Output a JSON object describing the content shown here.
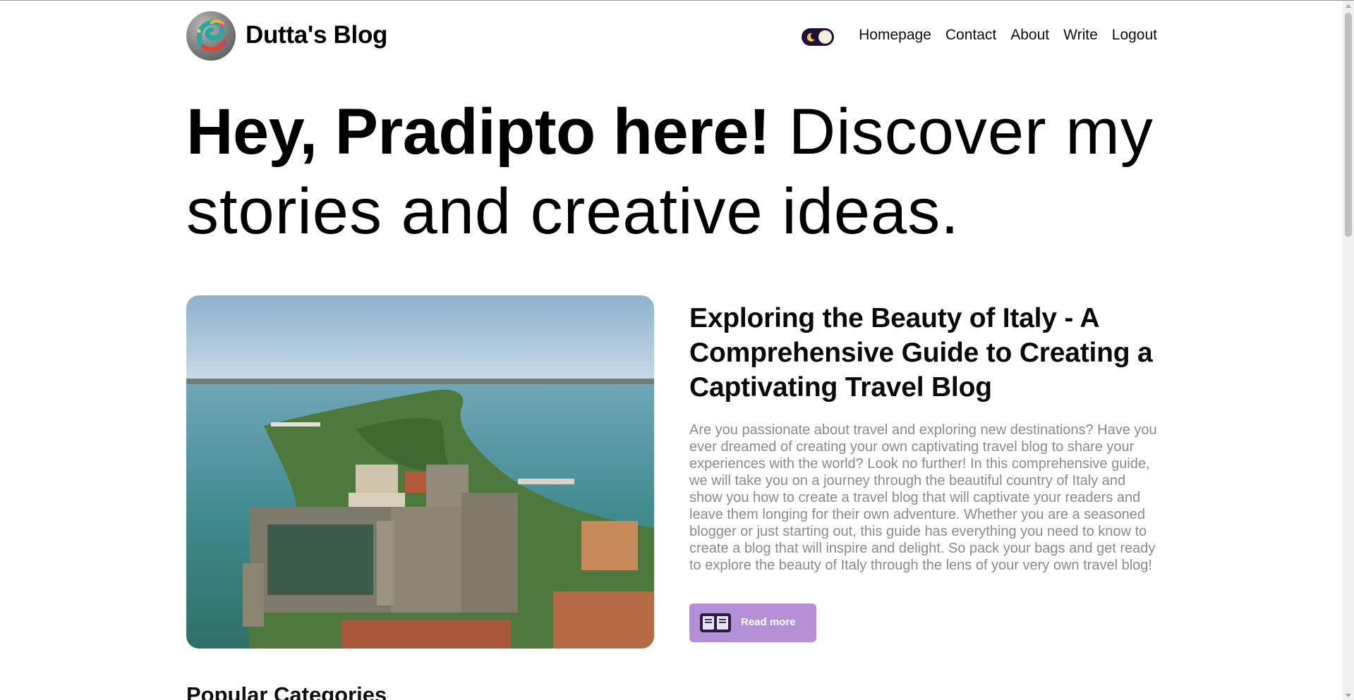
{
  "navbar": {
    "brand": "Dutta's Blog",
    "logo_icon": "colorful-swirl-logo-icon",
    "theme_toggle": {
      "state": "dark",
      "icon": "moon-icon"
    },
    "links": [
      "Homepage",
      "Contact",
      "About",
      "Write",
      "Logout"
    ]
  },
  "hero": {
    "bold": "Hey, Pradipto here!",
    "rest": " Discover my stories and creative ideas."
  },
  "featured_post": {
    "title": "Exploring the Beauty of Italy - A Comprehensive Guide to Creating a Captivating Travel Blog",
    "description": "Are you passionate about travel and exploring new destinations? Have you ever dreamed of creating your own captivating travel blog to share your experiences with the world? Look no further! In this comprehensive guide, we will take you on a journey through the beautiful country of Italy and show you how to create a travel blog that will captivate your readers and leave them longing for their own adventure. Whether you are a seasoned blogger or just starting out, this guide has everything you need to know to create a blog that will inspire and delight. So pack your bags and get ready to explore the beauty of Italy through the lens of your very own travel blog!",
    "image_icon": "lakeside-castle-photo",
    "read_more_label": "Read more",
    "read_more_icon": "open-book-icon"
  },
  "sections": {
    "popular_categories": "Popular Categories"
  },
  "colors": {
    "accent": "#b48fd6",
    "toggle_bg": "#200f3b",
    "description_text": "#8a8a8a"
  }
}
